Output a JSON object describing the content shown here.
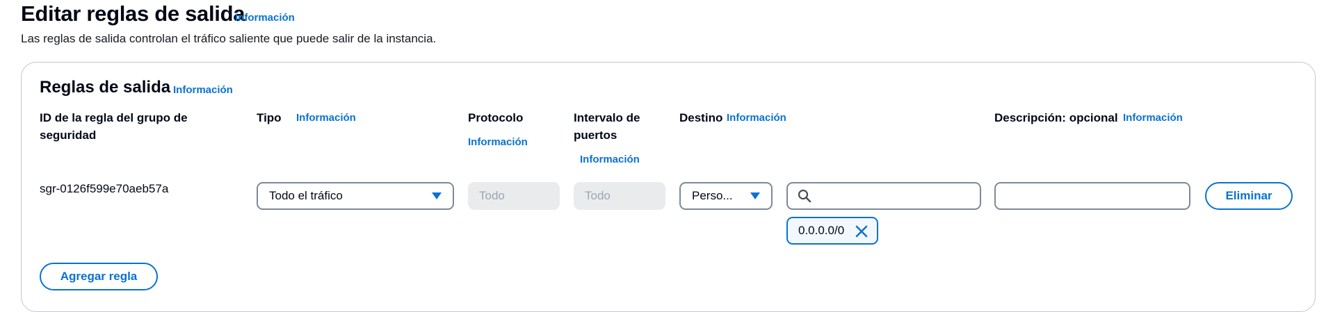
{
  "header": {
    "title": "Editar reglas de salida",
    "info": "Información",
    "description": "Las reglas de salida controlan el tráfico saliente que puede salir de la instancia."
  },
  "panel": {
    "title": "Reglas de salida",
    "info": "Información",
    "columns": {
      "rule_id": "ID de la regla del grupo de seguridad",
      "type": "Tipo",
      "type_info": "Información",
      "protocol": "Protocolo",
      "protocol_info": "Información",
      "port_range": "Intervalo de puertos",
      "port_range_info": "Información",
      "destination": "Destino",
      "destination_info": "Información",
      "description": "Descripción: opcional",
      "description_info": "Información"
    },
    "rule": {
      "id": "sgr-0126f599e70aeb57a",
      "type_value": "Todo el tráfico",
      "protocol_value": "Todo",
      "port_range_value": "Todo",
      "destination_select": "Perso...",
      "destination_search_value": "",
      "destination_token": "0.0.0.0/0",
      "description_value": "",
      "delete_label": "Eliminar"
    },
    "add_rule_label": "Agregar regla"
  },
  "colors": {
    "accent": "#0972d3",
    "text": "#000716",
    "disabled_bg": "#e9ebed",
    "border": "#7d8998"
  },
  "icons": [
    "caret-down-icon",
    "search-icon",
    "close-icon"
  ]
}
